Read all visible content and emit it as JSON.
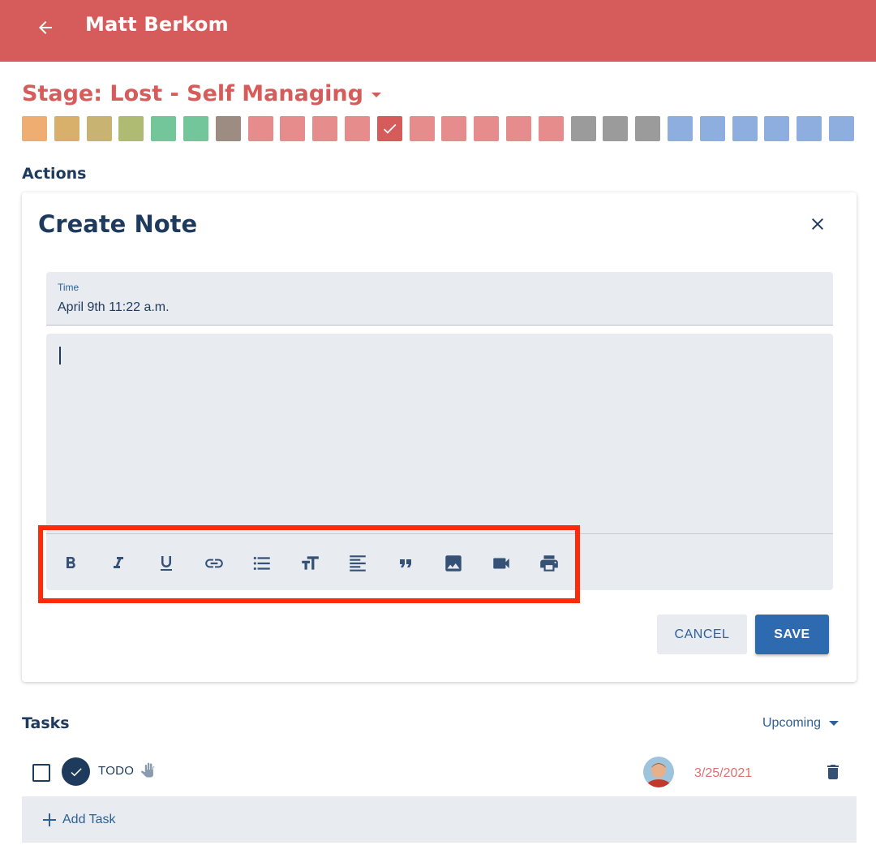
{
  "header": {
    "title": "Matt Berkom",
    "accent": "#d65c5c"
  },
  "stage": {
    "label": "Stage: Lost - Self Managing",
    "selected_index": 11,
    "swatch_colors": [
      "#f0ad72",
      "#d9b06b",
      "#c8b373",
      "#afbb72",
      "#73c69a",
      "#73c69a",
      "#9c8c82",
      "#e68c8c",
      "#e68c8c",
      "#e68c8c",
      "#e68c8c",
      "#d65c5c",
      "#e68c8c",
      "#e68c8c",
      "#e68c8c",
      "#e68c8c",
      "#e68c8c",
      "#9b9b9b",
      "#9b9b9b",
      "#9b9b9b",
      "#8faee0",
      "#8faee0",
      "#8faee0",
      "#8faee0",
      "#8faee0",
      "#8faee0"
    ]
  },
  "actions": {
    "section_title": "Actions",
    "card": {
      "title": "Create Note",
      "time_label": "Time",
      "time_value": "April 9th 11:22 a.m.",
      "toolbar": [
        {
          "icon": "bold-icon"
        },
        {
          "icon": "italic-icon"
        },
        {
          "icon": "underline-icon"
        },
        {
          "icon": "link-icon"
        },
        {
          "icon": "bulleted-list-icon"
        },
        {
          "icon": "text-size-icon"
        },
        {
          "icon": "align-left-icon"
        },
        {
          "icon": "quote-icon"
        },
        {
          "icon": "image-icon"
        },
        {
          "icon": "video-icon"
        },
        {
          "icon": "print-icon"
        }
      ],
      "cancel_label": "CANCEL",
      "save_label": "SAVE"
    }
  },
  "tasks": {
    "section_title": "Tasks",
    "filter_label": "Upcoming",
    "items": [
      {
        "label": "TODO",
        "date": "3/25/2021"
      }
    ],
    "add_label": "Add Task"
  }
}
